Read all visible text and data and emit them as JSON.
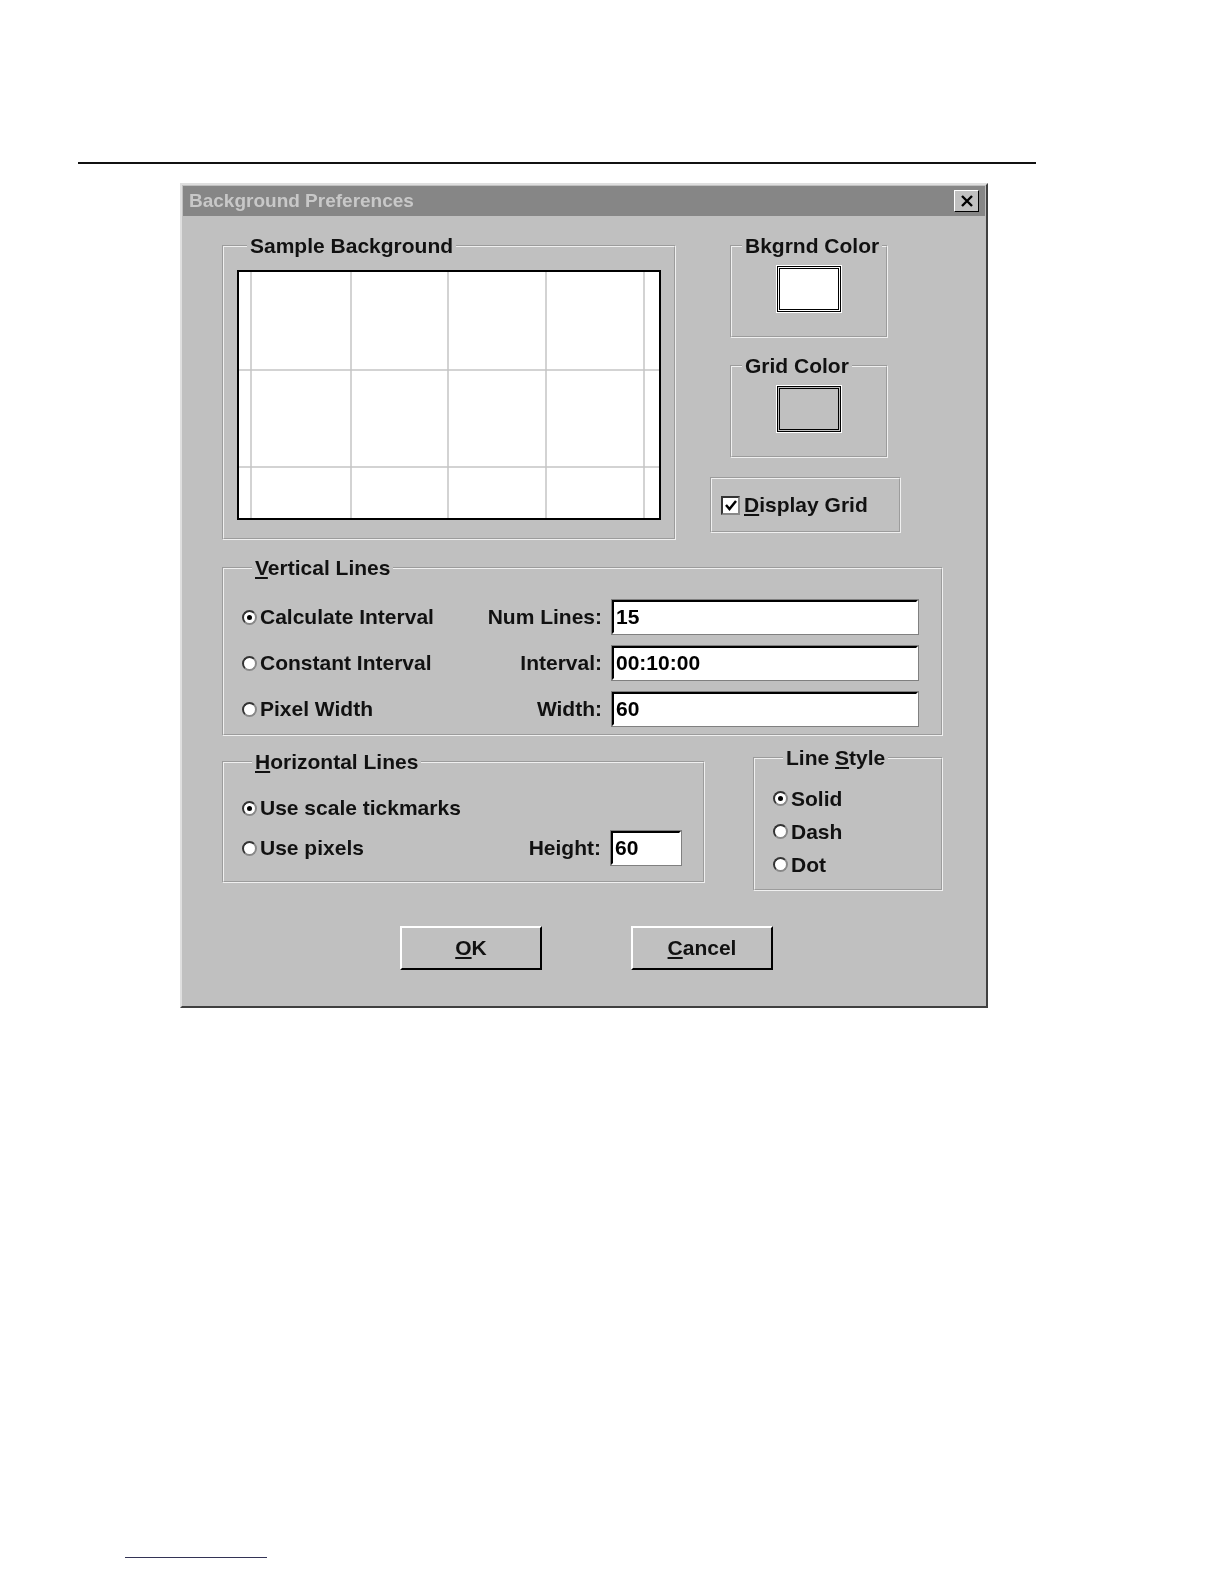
{
  "window": {
    "title": "Background Preferences"
  },
  "sample_background": {
    "title": "Sample Background"
  },
  "color_groups": [
    {
      "title": "Bkgrnd Color",
      "color": "#ffffff"
    },
    {
      "title": "Grid Color",
      "color": "#c0c0c0"
    }
  ],
  "display_grid": {
    "label": {
      "key": "D",
      "after": "isplay Grid"
    },
    "checked": true
  },
  "vertical_lines": {
    "title": {
      "key": "V",
      "after": "ertical Lines"
    },
    "options": [
      {
        "label": "Calculate Interval",
        "selected": true
      },
      {
        "label": "Constant Interval",
        "selected": false
      },
      {
        "label": "Pixel Width",
        "selected": false
      }
    ],
    "fields": [
      {
        "label": "Num Lines:",
        "value": "15"
      },
      {
        "label": "Interval:",
        "value": "00:10:00"
      },
      {
        "label": "Width:",
        "value": "60"
      }
    ]
  },
  "horizontal_lines": {
    "title": {
      "key": "H",
      "after": "orizontal Lines"
    },
    "options": [
      {
        "label": "Use scale tickmarks",
        "selected": true
      },
      {
        "label": "Use pixels",
        "selected": false
      }
    ],
    "field": {
      "label": "Height:",
      "value": "60"
    }
  },
  "line_style": {
    "title": {
      "before": "Line ",
      "key": "S",
      "after": "tyle"
    },
    "options": [
      {
        "label": "Solid",
        "selected": true
      },
      {
        "label": "Dash",
        "selected": false
      },
      {
        "label": "Dot",
        "selected": false
      }
    ]
  },
  "buttons": [
    {
      "label": {
        "key": "O",
        "after": "K"
      }
    },
    {
      "label": {
        "key": "C",
        "after": "ancel"
      }
    }
  ]
}
